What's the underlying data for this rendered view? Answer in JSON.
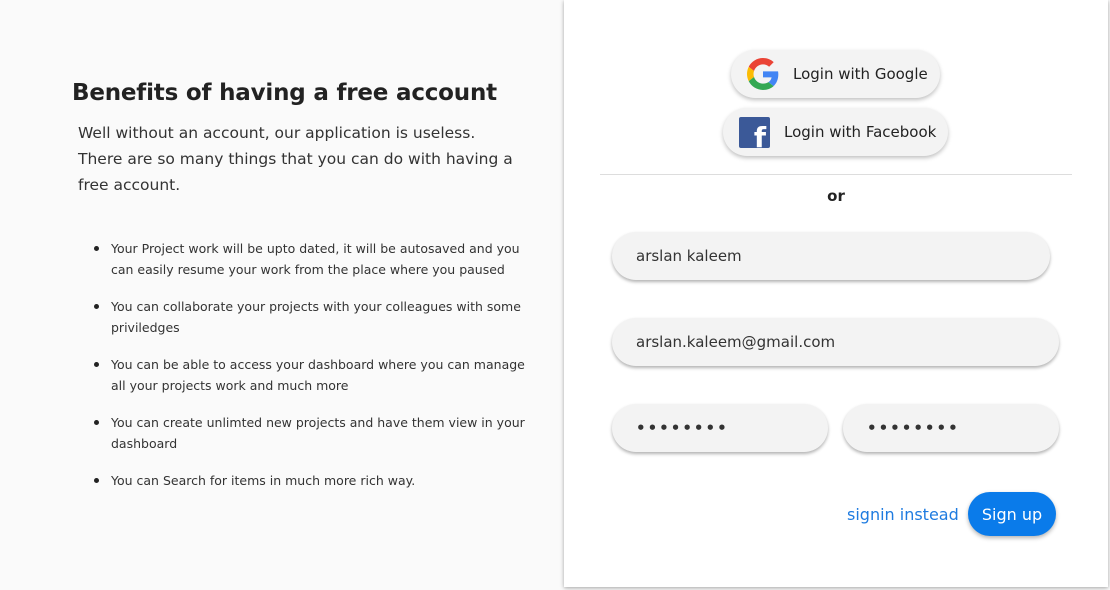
{
  "benefits_panel": {
    "title": "Benefits of having a free account",
    "intro": "Well without an account, our application is useless. There are so many things that you can do with having a free account.",
    "items": [
      "Your Project work will be upto dated, it will be autosaved and you can easily resume your work from the place where you paused",
      "You can collaborate your projects with your colleagues with some priviledges",
      "You can be able to access your dashboard where you can manage all your projects work and much more",
      "You can create unlimted new projects and have them view in your dashboard",
      "You can Search for items in much more rich way."
    ]
  },
  "signup_card": {
    "google_label": "Login with Google",
    "facebook_label": "Login with Facebook",
    "google_icon": "google-g-icon",
    "facebook_icon": "facebook-f-icon",
    "or_text": "or",
    "name_value": "arslan kaleem",
    "email_value": "arslan.kaleem@gmail.com",
    "password_value": "••••••••",
    "confirm_password_value": "••••••••",
    "signin_link": "signin instead",
    "signup_button": "Sign up",
    "accent_color": "#0a7bea",
    "facebook_color": "#3b5998"
  }
}
